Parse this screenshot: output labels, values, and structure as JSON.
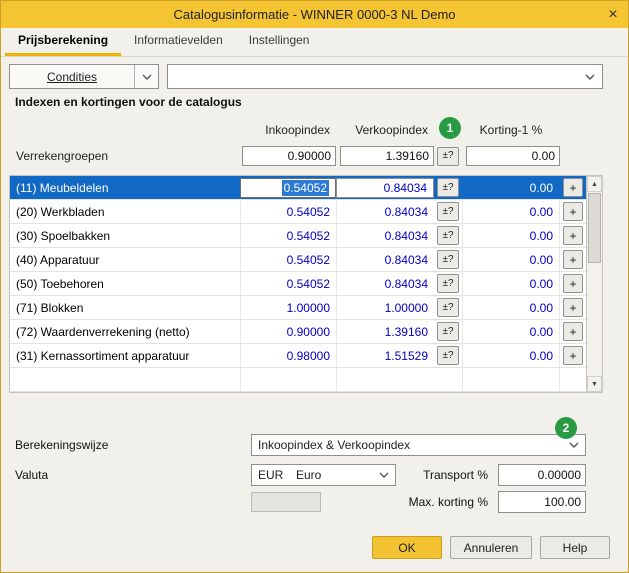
{
  "dialog": {
    "title": "Catalogusinformatie - WINNER 0000-3 NL Demo"
  },
  "icons": {
    "close": "×",
    "scroll_up": "▲",
    "scroll_down": "▼"
  },
  "tabs": [
    {
      "label": "Prijsberekening"
    },
    {
      "label": "Informatievelden"
    },
    {
      "label": "Instellingen"
    }
  ],
  "toolbar": {
    "condities_label": "Condities",
    "combo_value": ""
  },
  "section": {
    "title": "Indexen en kortingen voor de catalogus"
  },
  "columns": {
    "inkoopindex": "Inkoopindex",
    "verkoopindex": "Verkoopindex",
    "korting": "Korting-1 %"
  },
  "controls": {
    "pm_label": "±?",
    "plus_label": "+"
  },
  "verrekengroepen": {
    "label": "Verrekengroepen",
    "inkoop": "0.90000",
    "verkoop": "1.39160",
    "korting": "0.00"
  },
  "rows": [
    {
      "label": "(11) Meubeldelen",
      "inkoop": "0.54052",
      "verkoop": "0.84034",
      "korting": "0.00"
    },
    {
      "label": "(20) Werkbladen",
      "inkoop": "0.54052",
      "verkoop": "0.84034",
      "korting": "0.00"
    },
    {
      "label": "(30) Spoelbakken",
      "inkoop": "0.54052",
      "verkoop": "0.84034",
      "korting": "0.00"
    },
    {
      "label": "(40) Apparatuur",
      "inkoop": "0.54052",
      "verkoop": "0.84034",
      "korting": "0.00"
    },
    {
      "label": "(50) Toebehoren",
      "inkoop": "0.54052",
      "verkoop": "0.84034",
      "korting": "0.00"
    },
    {
      "label": "(71) Blokken",
      "inkoop": "1.00000",
      "verkoop": "1.00000",
      "korting": "0.00"
    },
    {
      "label": "(72) Waardenverrekening (netto)",
      "inkoop": "0.90000",
      "verkoop": "1.39160",
      "korting": "0.00"
    },
    {
      "label": "(31) Kernassortiment apparatuur",
      "inkoop": "0.98000",
      "verkoop": "1.51529",
      "korting": "0.00"
    },
    {
      "label": "",
      "inkoop": "",
      "verkoop": "",
      "korting": ""
    }
  ],
  "badges": {
    "step1": "1",
    "step2": "2"
  },
  "form": {
    "berekeningswijze_label": "Berekeningswijze",
    "berekeningswijze_value": "Inkoopindex & Verkoopindex",
    "valuta_label": "Valuta",
    "valuta_code": "EUR",
    "valuta_name": "Euro",
    "transport_label": "Transport %",
    "transport_value": "0.00000",
    "max_korting_label": "Max. korting %",
    "max_korting_value": "100.00"
  },
  "buttons": {
    "ok": "OK",
    "annuleren": "Annuleren",
    "help": "Help"
  }
}
